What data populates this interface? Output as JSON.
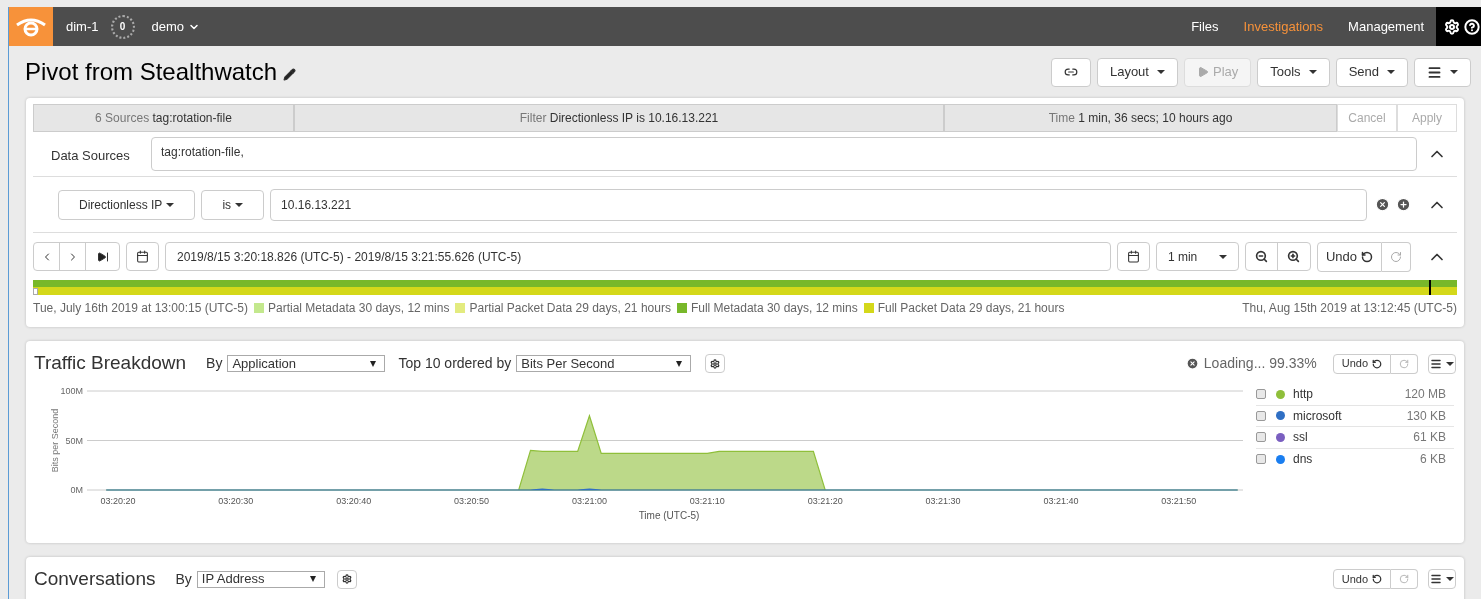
{
  "topbar": {
    "instance": "dim-1",
    "badge": "0",
    "workspace": "demo",
    "nav": [
      {
        "label": "Files",
        "selected": false
      },
      {
        "label": "Investigations",
        "selected": true
      },
      {
        "label": "Management",
        "selected": false
      }
    ]
  },
  "title": "Pivot from Stealthwatch",
  "toolbar": [
    {
      "kind": "link",
      "disabled": false
    },
    {
      "kind": "text",
      "label": "Layout",
      "disabled": false
    },
    {
      "kind": "play",
      "label": "Play",
      "disabled": true
    },
    {
      "kind": "text",
      "label": "Tools",
      "disabled": false
    },
    {
      "kind": "text",
      "label": "Send",
      "disabled": false
    },
    {
      "kind": "menu",
      "disabled": false
    }
  ],
  "summary": {
    "segments": [
      {
        "prefix": "6 Sources",
        "value": "tag:rotation-file"
      },
      {
        "prefix": "Filter",
        "value": "Directionless IP is 10.16.13.221"
      },
      {
        "prefix": "Time",
        "value": "1 min, 36 secs; 10 hours ago"
      }
    ],
    "actions": [
      {
        "label": "Cancel",
        "disabled": true
      },
      {
        "label": "Apply",
        "disabled": true
      }
    ]
  },
  "data_sources": {
    "label": "Data Sources",
    "value": "tag:rotation-file,"
  },
  "filter": {
    "field": "Directionless IP",
    "operator": "is",
    "value": "10.16.13.221"
  },
  "time": {
    "range": "2019/8/15 3:20:18.826 (UTC-5) - 2019/8/15 3:21:55.626 (UTC-5)",
    "interval": "1 min",
    "undo": "Undo"
  },
  "timeline": {
    "start": "Tue, July 16th 2019 at 13:00:15 (UTC-5)",
    "end": "Thu, Aug 15th 2019 at 13:12:45 (UTC-5)",
    "legend": [
      {
        "label": "Partial Metadata 30 days, 12 mins",
        "color": "#c3e88d"
      },
      {
        "label": "Partial Packet Data 29 days, 21 hours",
        "color": "#e3eb7f"
      },
      {
        "label": "Full Metadata 30 days, 12 mins",
        "color": "#78b82a"
      },
      {
        "label": "Full Packet Data 29 days, 21 hours",
        "color": "#d4d81a"
      }
    ]
  },
  "traffic": {
    "title": "Traffic Breakdown",
    "by_label": "By",
    "by_value": "Application",
    "order_label": "Top 10 ordered by",
    "order_value": "Bits Per Second",
    "loading": "Loading... 99.33%",
    "undo": "Undo",
    "legend": [
      {
        "size": "120 MB",
        "checked": false
      },
      {
        "size": "130 KB",
        "checked": false
      },
      {
        "name": "ssl",
        "color": "#7a5fc0",
        "size": "61 KB",
        "checked": false
      },
      {
        "name": "dns",
        "color": "#1a7ef0",
        "size": "6 KB",
        "checked": false
      }
    ],
    "chart_data": {
      "type": "area",
      "ylabel": "Bits per Second",
      "xlabel": "Time (UTC-5)",
      "categories": [
        null,
        "03:20:20",
        null,
        null,
        null,
        null,
        null,
        null,
        null,
        null,
        null,
        "03:20:30",
        null,
        null,
        null,
        null,
        null,
        null,
        null,
        null,
        null,
        "03:20:40",
        null,
        null,
        null,
        null,
        null,
        null,
        null,
        null,
        null,
        "03:20:50",
        null,
        null,
        null,
        null,
        null,
        null,
        null,
        null,
        null,
        "03:21:00",
        null,
        null,
        null,
        null,
        null,
        null,
        null,
        null,
        null,
        "03:21:10",
        null,
        null,
        null,
        null,
        null,
        null,
        null,
        null,
        null,
        "03:21:20",
        null,
        null,
        null,
        null,
        null,
        null,
        null,
        null,
        null,
        "03:21:30",
        null,
        null,
        null,
        null,
        null,
        null,
        null,
        null,
        null,
        "03:21:40",
        null,
        null,
        null,
        null,
        null,
        null,
        null,
        null,
        null,
        "03:21:50",
        null,
        null,
        null,
        null,
        null
      ],
      "series": [
        {
          "name": "http",
          "color": "#8fbf3a",
          "values": [
            0,
            0,
            0,
            0,
            0,
            0,
            0,
            0,
            0,
            0,
            0,
            0,
            0,
            0,
            0,
            0,
            0,
            0,
            0,
            0,
            0,
            0,
            0,
            0,
            0,
            0,
            0,
            0,
            0,
            0,
            0,
            0,
            0,
            0,
            0,
            0,
            40,
            39,
            39,
            39,
            39,
            75,
            37,
            37,
            37,
            37,
            37,
            37,
            37,
            37,
            37,
            37,
            39,
            39,
            39,
            39,
            39,
            39,
            39,
            39,
            39,
            0,
            0,
            0,
            0,
            0,
            0,
            0,
            0,
            0,
            0,
            0,
            0,
            0,
            0,
            0,
            0,
            0,
            0,
            0,
            0,
            0,
            0,
            0,
            0,
            0,
            0,
            0,
            0,
            0,
            0,
            0,
            0,
            0,
            0,
            0,
            0
          ]
        },
        {
          "name": "microsoft",
          "color": "#2f6fc4",
          "values": [
            0,
            0,
            0,
            0,
            0,
            0,
            0,
            0,
            0,
            0,
            0,
            0,
            0,
            0,
            0,
            0,
            0,
            0,
            0,
            0,
            0,
            0,
            0,
            0,
            0,
            0,
            0,
            0,
            0,
            0,
            0,
            0,
            0,
            0,
            0,
            0,
            0,
            1,
            0,
            0,
            0,
            1,
            0,
            0,
            0,
            0,
            0,
            0,
            0,
            0,
            0,
            0,
            0,
            0,
            0,
            0,
            0,
            0,
            0,
            0,
            0,
            0,
            0,
            0,
            0,
            0,
            0,
            0,
            0,
            0,
            0,
            0,
            0,
            0,
            0,
            0,
            0,
            0,
            0,
            0,
            0,
            0,
            0,
            0,
            0,
            0,
            0,
            0,
            0,
            0,
            0,
            0,
            0,
            0,
            0,
            0,
            0
          ]
        }
      ],
      "ylim": [
        0,
        100
      ],
      "yticks": [
        {
          "value": 0,
          "label": "0M"
        },
        {
          "value": 50,
          "label": "50M"
        },
        {
          "value": 100,
          "label": "100M"
        }
      ]
    }
  },
  "conversations": {
    "title": "Conversations",
    "by_label": "By",
    "by_value": "IP Address",
    "undo": "Undo"
  }
}
